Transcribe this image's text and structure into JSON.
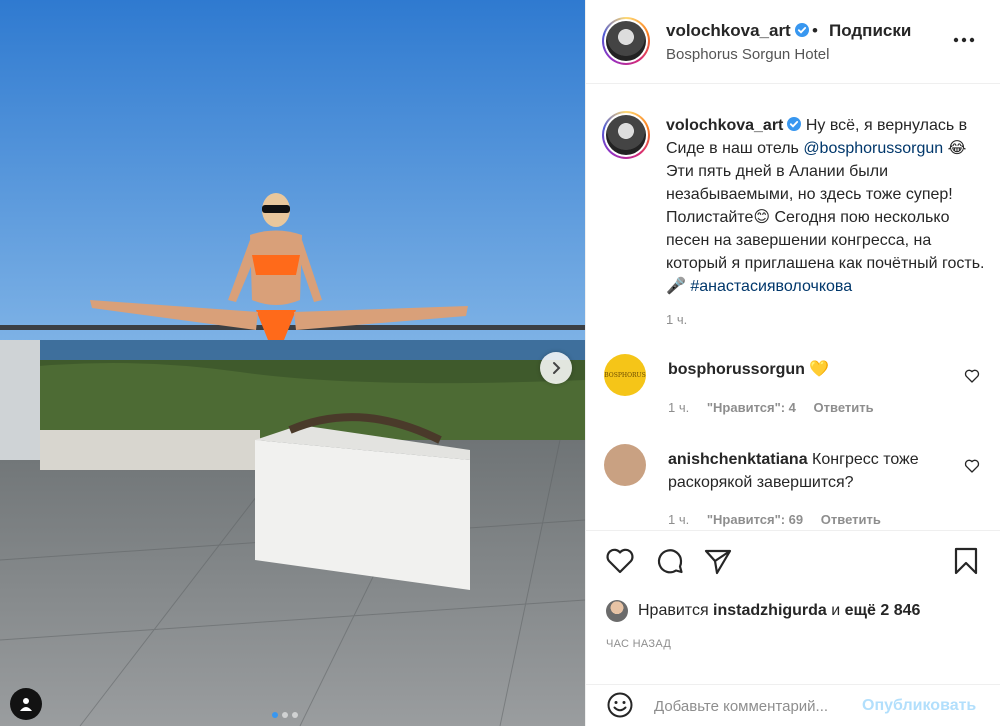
{
  "post": {
    "username": "volochkova_art",
    "separator": "•",
    "follow_label": "Подписки",
    "location": "Bosphorus Sorgun Hotel"
  },
  "caption": {
    "username": "volochkova_art",
    "text_1": " Ну всё, я вернулась в Сиде в наш отель ",
    "mention": "@bosphorussorgun",
    "text_2": " 😂 Эти пять дней в Алании были незабываемыми, но здесь тоже супер! Полистайте😊 Сегодня пою несколько песен на завершении конгресса, на который я приглашена как почётный гость.🎤 ",
    "hashtag": "#анастасияволочкова",
    "time": "1 ч."
  },
  "comments": [
    {
      "username": "bosphorussorgun",
      "text": " 💛",
      "avatar_text": "BOSPHORUS",
      "time": "1 ч.",
      "likes": "\"Нравится\": 4",
      "reply": "Ответить"
    },
    {
      "username": "anishchenktatiana",
      "text": " Конгресс тоже раскорякой завершится?",
      "time": "1 ч.",
      "likes": "\"Нравится\": 69",
      "reply": "Ответить"
    }
  ],
  "likes": {
    "prefix": "Нравится ",
    "user": "instadzhigurda",
    "suffix": " и ",
    "count": "ещё 2 846"
  },
  "timestamp": "ЧАС НАЗАД",
  "add_comment": {
    "placeholder": "Добавьте комментарий...",
    "post_label": "Опубликовать"
  },
  "carousel": {
    "total": 3,
    "current": 1
  },
  "colors": {
    "accent": "#3897f0",
    "link": "#00376b",
    "muted": "#8e8e8e",
    "post_disabled": "#b2dffc",
    "sky": "#3f88d9"
  },
  "icons": [
    "verified-icon",
    "more-icon",
    "heart-icon",
    "comment-icon",
    "share-icon",
    "bookmark-icon",
    "emoji-icon",
    "chevron-right-icon",
    "user-tag-icon"
  ]
}
